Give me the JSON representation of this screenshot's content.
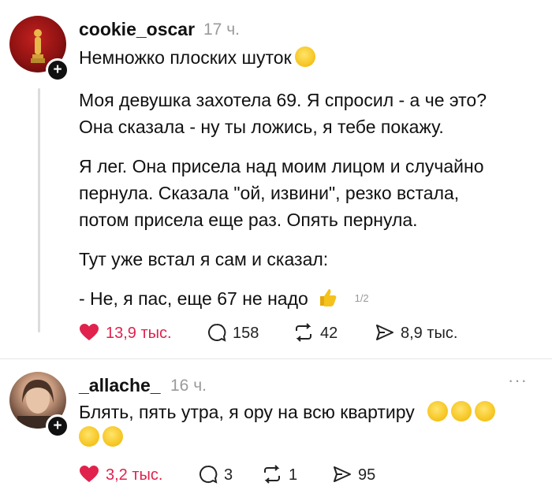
{
  "post1": {
    "username": "cookie_oscar",
    "time": "17 ч.",
    "lines": [
      "Немножко плоских шуток",
      "Моя девушка захотела 69. Я спросил - а че это?",
      "Она сказала - ну ты ложись, я тебе покажу.",
      "Я лег. Она присела над моим лицом и случайно",
      "пернула. Сказала \"ой, извини\", резко встала,",
      "потом присела еще раз. Опять пернула.",
      "Тут уже встал я сам и сказал:",
      "- Не, я пас, еще 67 не надо"
    ],
    "pager": "1/2",
    "likes": "13,9 тыс.",
    "comments": "158",
    "reposts": "42",
    "shares": "8,9 тыс.",
    "icons": [
      "oscar-statue-avatar",
      "smile-emoji",
      "thumbs-up-emoji",
      "heart-icon",
      "comment-icon",
      "repost-icon",
      "share-icon"
    ]
  },
  "post2": {
    "username": "_allache_",
    "time": "16 ч.",
    "line1": "Блять, пять утра, я ору на всю квартиру",
    "likes": "3,2 тыс.",
    "comments": "3",
    "reposts": "1",
    "shares": "95",
    "icons": [
      "rofl-emoji",
      "more-icon"
    ]
  },
  "colors": {
    "like": "#e0224d",
    "muted": "#9a9a9a",
    "text": "#111111"
  }
}
